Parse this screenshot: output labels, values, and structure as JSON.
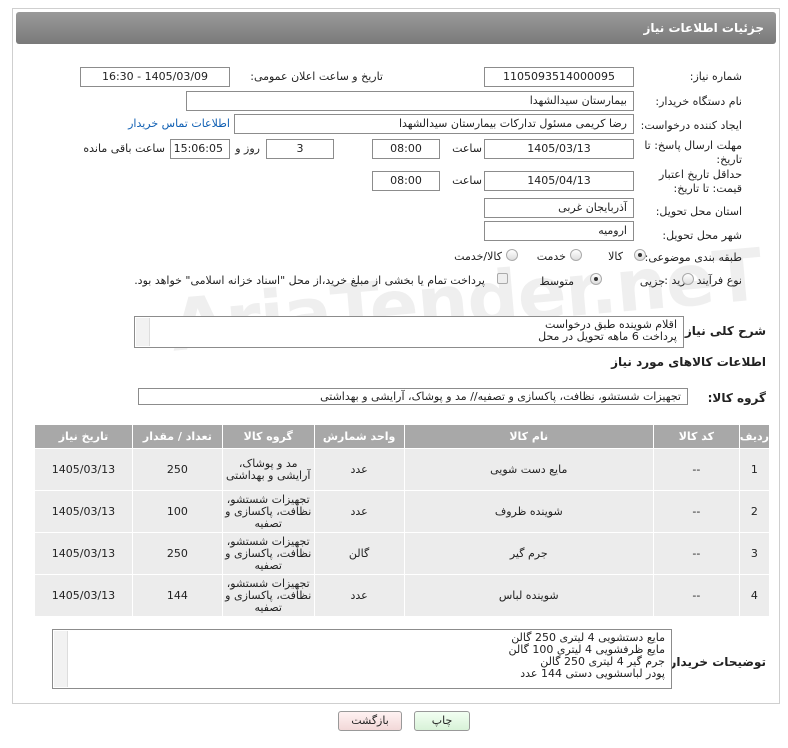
{
  "header": {
    "title": "جزئیات اطلاعات نیاز"
  },
  "labels": {
    "need_number": "شماره نیاز:",
    "announce_datetime": "تاریخ و ساعت اعلان عمومی:",
    "buyer_org": "نام دستگاه خریدار:",
    "creator": "ایجاد کننده درخواست:",
    "reply_deadline": "مهلت ارسال پاسخ: تا تاریخ:",
    "time_word": "ساعت",
    "day_word": "روز و",
    "remaining": "ساعت باقی مانده",
    "price_validity": "حداقل تاریخ اعتبار قیمت: تا تاریخ:",
    "province": "استان محل تحویل:",
    "city": "شهر محل تحویل:",
    "category": "طبقه بندی موضوعی:",
    "process_type": "نوع فرآیند خرید :",
    "general_desc": "شرح کلی نیاز:",
    "goods_info": "اطلاعات کالاهای مورد نیاز",
    "goods_group": "گروه کالا:",
    "buyer_notes": "توضیحات خریدار:"
  },
  "fields": {
    "need_number": "1105093514000095",
    "announce_datetime": "1405/03/09 - 16:30",
    "buyer_org": "بیمارستان سیدالشهدا",
    "creator": "رضا کریمی مسئول تدارکات بیمارستان سیدالشهدا",
    "contact_link": "اطلاعات تماس خریدار",
    "reply_date": "1405/03/13",
    "reply_time": "08:00",
    "days": "3",
    "remaining_time": "15:06:05",
    "validity_date": "1405/04/13",
    "validity_time": "08:00",
    "province": "آذربایجان غربی",
    "city": "ارومیه"
  },
  "category_options": [
    {
      "label": "کالا",
      "selected": true
    },
    {
      "label": "خدمت",
      "selected": false
    },
    {
      "label": "کالا/خدمت",
      "selected": false
    }
  ],
  "process_options": [
    {
      "label": "جزیی",
      "selected": false
    },
    {
      "label": "متوسط",
      "selected": true
    }
  ],
  "process_note": "پرداخت تمام یا بخشی از مبلغ خرید،از محل \"اسناد خزانه اسلامی\" خواهد بود.",
  "general_desc_lines": [
    "اقلام شوینده طبق درخواست",
    "پرداخت 6 ماهه تحویل در محل"
  ],
  "goods_group_value": "تجهیزات شستشو، نظافت، پاکسازی و تصفیه// مد و پوشاک، آرایشی و بهداشتی",
  "table": {
    "headers": [
      "ردیف",
      "کد کالا",
      "نام کالا",
      "واحد شمارش",
      "گروه کالا",
      "تعداد / مقدار",
      "تاریخ نیاز"
    ],
    "rows": [
      [
        "1",
        "--",
        "مایع دست شویی",
        "عدد",
        "مد و پوشاک، آرایشی و بهداشتی",
        "250",
        "1405/03/13"
      ],
      [
        "2",
        "--",
        "شوینده ظروف",
        "عدد",
        "تجهیزات شستشو، نظافت، پاکسازی و تصفیه",
        "100",
        "1405/03/13"
      ],
      [
        "3",
        "--",
        "جرم گیر",
        "گالن",
        "تجهیزات شستشو، نظافت، پاکسازی و تصفیه",
        "250",
        "1405/03/13"
      ],
      [
        "4",
        "--",
        "شوینده لباس",
        "عدد",
        "تجهیزات شستشو، نظافت، پاکسازی و تصفیه",
        "144",
        "1405/03/13"
      ]
    ]
  },
  "buyer_notes_lines": [
    "مایع دستشویی 4 لیتری 250 گالن",
    "مایع ظرفشویی 4 لیتری 100 گالن",
    "جرم گیر 4 لیتری 250 گالن",
    "پودر لباسشویی دستی 144 عدد"
  ],
  "buttons": {
    "print": "چاپ",
    "back": "بازگشت"
  },
  "watermark": "AriaTender.neT"
}
